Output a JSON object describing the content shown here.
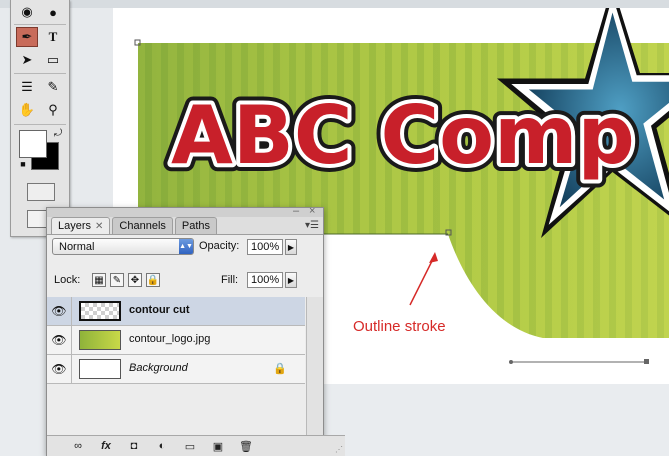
{
  "canvas": {
    "logo_text": "ABC Comp",
    "colors": {
      "green_light": "#c8d84a",
      "green_dark": "#7ea63a",
      "text_red": "#c8202a",
      "star_blue": "#1f5a7a"
    }
  },
  "tools": {
    "items": [
      {
        "name": "blur-icon",
        "glyph": "💧"
      },
      {
        "name": "dodge-icon",
        "glyph": "🔍"
      },
      {
        "name": "pen-icon",
        "glyph": "✒"
      },
      {
        "name": "type-icon",
        "glyph": "T"
      },
      {
        "name": "path-select-icon",
        "glyph": "➤"
      },
      {
        "name": "rectangle-icon",
        "glyph": "▭"
      },
      {
        "name": "notes-icon",
        "glyph": "📝"
      },
      {
        "name": "eyedropper-icon",
        "glyph": "✎"
      },
      {
        "name": "hand-icon",
        "glyph": "✋"
      },
      {
        "name": "zoom-icon",
        "glyph": "🔍"
      }
    ]
  },
  "layers_panel": {
    "tabs": [
      {
        "label": "Layers",
        "active": true
      },
      {
        "label": "Channels",
        "active": false
      },
      {
        "label": "Paths",
        "active": false
      }
    ],
    "blend_mode": "Normal",
    "opacity_label": "Opacity:",
    "opacity_value": "100%",
    "lock_label": "Lock:",
    "fill_label": "Fill:",
    "fill_value": "100%",
    "layers": [
      {
        "name": "contour cut",
        "style": "bold",
        "selected": true,
        "thumb": "checker"
      },
      {
        "name": "contour_logo.jpg",
        "style": "normal",
        "selected": false,
        "thumb": "logo"
      },
      {
        "name": "Background",
        "style": "italic",
        "selected": false,
        "thumb": "white",
        "locked": true
      }
    ],
    "bottom_buttons": [
      {
        "name": "link-icon",
        "glyph": "∞"
      },
      {
        "name": "fx-icon",
        "glyph": "fx"
      },
      {
        "name": "mask-icon",
        "glyph": "◘"
      },
      {
        "name": "adjustment-icon",
        "glyph": "◐"
      },
      {
        "name": "group-folder-icon",
        "glyph": "▭"
      },
      {
        "name": "new-layer-icon",
        "glyph": "▣"
      },
      {
        "name": "trash-icon",
        "glyph": "🗑"
      }
    ]
  },
  "annotation": {
    "label": "Outline stroke",
    "color": "#d62a28"
  }
}
